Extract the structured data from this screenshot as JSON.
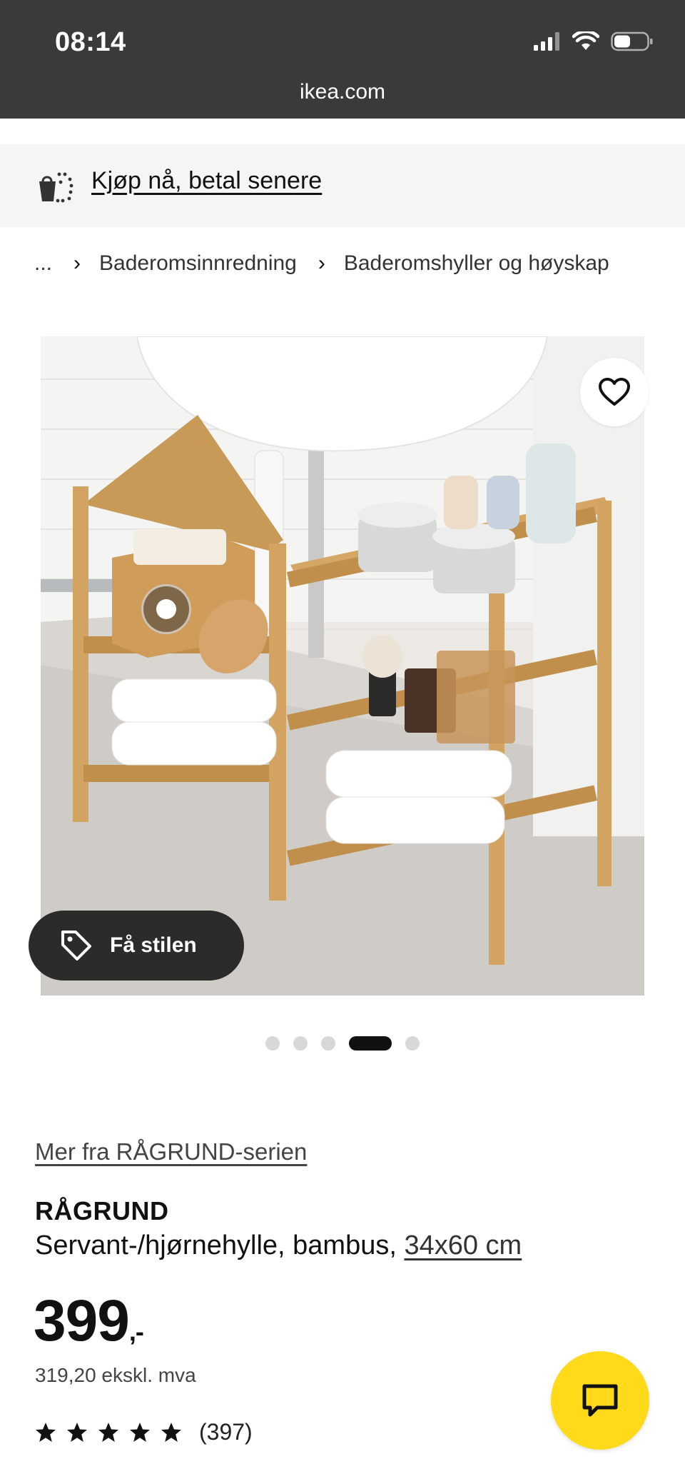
{
  "status_bar": {
    "time": "08:14",
    "url": "ikea.com",
    "icons": [
      "signal-icon",
      "wifi-icon",
      "battery-icon"
    ]
  },
  "banner": {
    "icon": "shopping-bag-icon",
    "link_text": "Kjøp nå, betal senere"
  },
  "breadcrumb": {
    "items": [
      "...",
      "Baderomsinnredning",
      "Baderomshyller og høyskap"
    ]
  },
  "gallery": {
    "image_alt": "RÅGRUND servant-/hjørnehylle i bambus under en vask med håndklær og baderomsartikler",
    "style_button_label": "Få stilen",
    "dots_count": 5,
    "active_dot": 4,
    "favorite_icon": "heart-icon"
  },
  "product": {
    "series_link": "Mer fra RÅGRUND-serien",
    "name": "RÅGRUND",
    "description": "Servant-/hjørnehylle, bambus,",
    "size_link": "34x60 cm",
    "price": "399",
    "price_suffix": ",-",
    "price_ex_vat": "319,20 ekskl. mva",
    "rating_stars": 5,
    "review_count": "(397)"
  },
  "chat": {
    "icon": "chat-icon"
  },
  "colors": {
    "status_bar_bg": "#383a3c",
    "banner_bg": "#f5f5f5",
    "chat_yellow": "#ffda1a",
    "style_button_bg": "#2b2b2b"
  }
}
